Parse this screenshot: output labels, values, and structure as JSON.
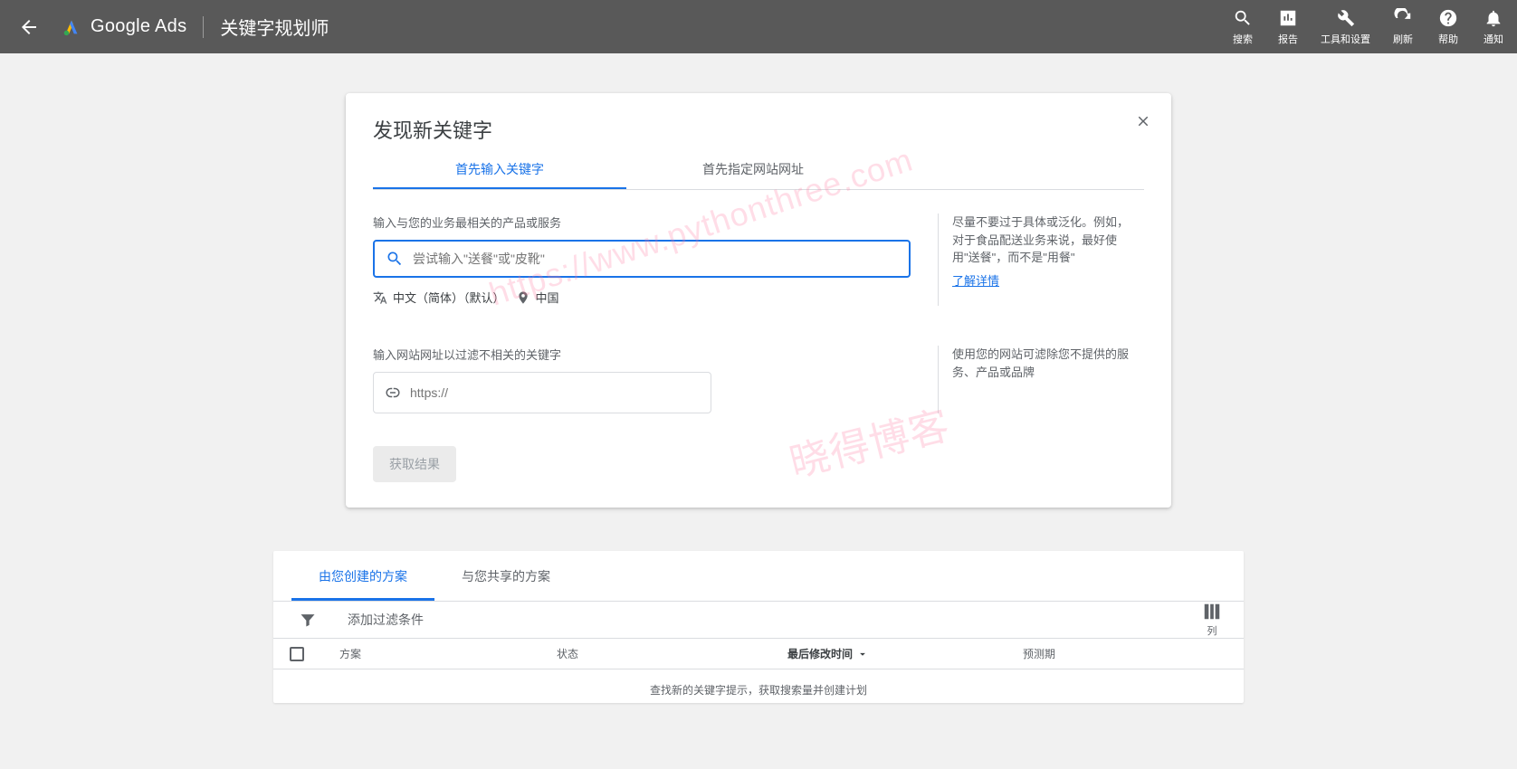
{
  "header": {
    "logo_text": "Google Ads",
    "page_title": "关键字规划师",
    "actions": {
      "search": "搜索",
      "report": "报告",
      "tools": "工具和设置",
      "refresh": "刷新",
      "help": "帮助",
      "notify": "通知"
    }
  },
  "card": {
    "title": "发现新关键字",
    "tabs": {
      "t1": "首先输入关键字",
      "t2": "首先指定网站网址"
    },
    "s1_label": "输入与您的业务最相关的产品或服务",
    "search_placeholder": "尝试输入\"送餐\"或\"皮靴\"",
    "language": "中文（简体）（默认）",
    "location": "中国",
    "tip1": "尽量不要过于具体或泛化。例如，对于食品配送业务来说，最好使用\"送餐\"，而不是\"用餐\"",
    "learn_more": "了解详情",
    "s2_label": "输入网站网址以过滤不相关的关键字",
    "url_placeholder": "https://",
    "tip2": "使用您的网站可滤除您不提供的服务、产品或品牌",
    "btn": "获取结果"
  },
  "plans": {
    "tab1": "由您创建的方案",
    "tab2": "与您共享的方案",
    "filter": "添加过滤条件",
    "columns": "列",
    "th_plan": "方案",
    "th_status": "状态",
    "th_mod": "最后修改时间",
    "th_forecast": "预测期",
    "empty": "查找新的关键字提示，获取搜索量并创建计划"
  },
  "watermarks": {
    "wm1": "https://www.pythonthree.com",
    "wm2": "晓得博客"
  }
}
